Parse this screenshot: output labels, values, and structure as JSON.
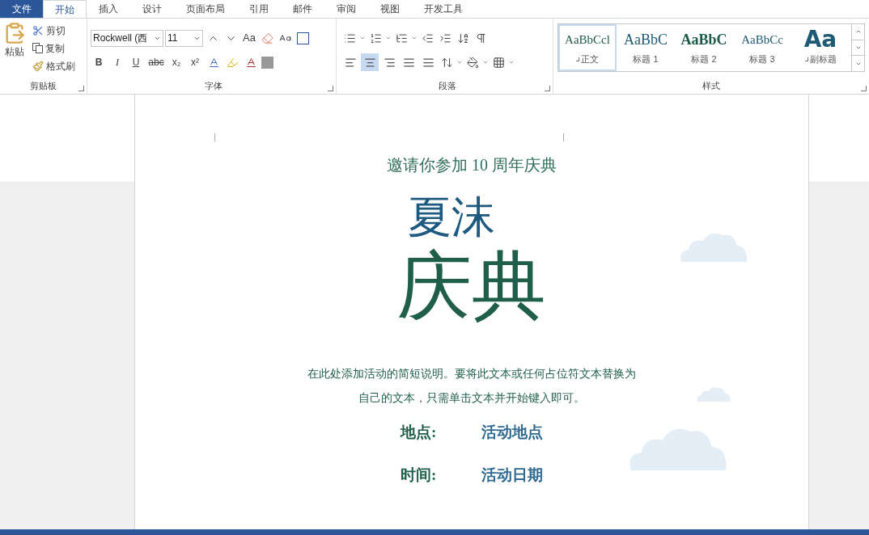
{
  "file_tab": "文件",
  "tabs": [
    {
      "label": "开始",
      "selected": true
    },
    {
      "label": "插入",
      "selected": false
    },
    {
      "label": "设计",
      "selected": false
    },
    {
      "label": "页面布局",
      "selected": false
    },
    {
      "label": "引用",
      "selected": false
    },
    {
      "label": "邮件",
      "selected": false
    },
    {
      "label": "审阅",
      "selected": false
    },
    {
      "label": "视图",
      "selected": false
    },
    {
      "label": "开发工具",
      "selected": false
    }
  ],
  "clipboard": {
    "paste": "粘贴",
    "cut": "剪切",
    "copy": "复制",
    "format_painter": "格式刷",
    "group_label": "剪贴板"
  },
  "font": {
    "font_name": "Rockwell (西",
    "font_size": "11",
    "change_case": "Aa",
    "format_buttons": [
      "B",
      "I",
      "U",
      "abc",
      "x₂",
      "x²"
    ],
    "group_label": "字体"
  },
  "paragraph": {
    "alignments": [
      {
        "kind": "left",
        "selected": false
      },
      {
        "kind": "center",
        "selected": true
      },
      {
        "kind": "right",
        "selected": false
      },
      {
        "kind": "justify",
        "selected": false
      },
      {
        "kind": "distributed",
        "selected": false
      }
    ],
    "group_label": "段落"
  },
  "styles": {
    "items": [
      {
        "preview": "AaBbCcl",
        "label": "正文",
        "selected": true,
        "paragraph_mark": true,
        "kind": "normal"
      },
      {
        "preview": "AaBbC",
        "label": "标题 1",
        "selected": false,
        "paragraph_mark": false,
        "kind": "heading1"
      },
      {
        "preview": "AaBbC",
        "label": "标题 2",
        "selected": false,
        "paragraph_mark": false,
        "kind": "heading2"
      },
      {
        "preview": "AaBbCc",
        "label": "标题 3",
        "selected": false,
        "paragraph_mark": false,
        "kind": "heading3"
      },
      {
        "preview": "Aa",
        "label": "副标题",
        "selected": false,
        "paragraph_mark": true,
        "kind": "subtitle"
      }
    ],
    "group_label": "样式"
  },
  "document": {
    "subtitle": "邀请你参加 10 周年庆典",
    "title_line_1": "夏沫",
    "title_line_2": "庆典",
    "description": "在此处添加活动的简短说明。要将此文本或任何占位符文本替换为自己的文本，只需单击文本并开始键入即可。",
    "details": [
      {
        "label": "地点:",
        "value": "活动地点"
      },
      {
        "label": "时间:",
        "value": "活动日期"
      }
    ]
  }
}
